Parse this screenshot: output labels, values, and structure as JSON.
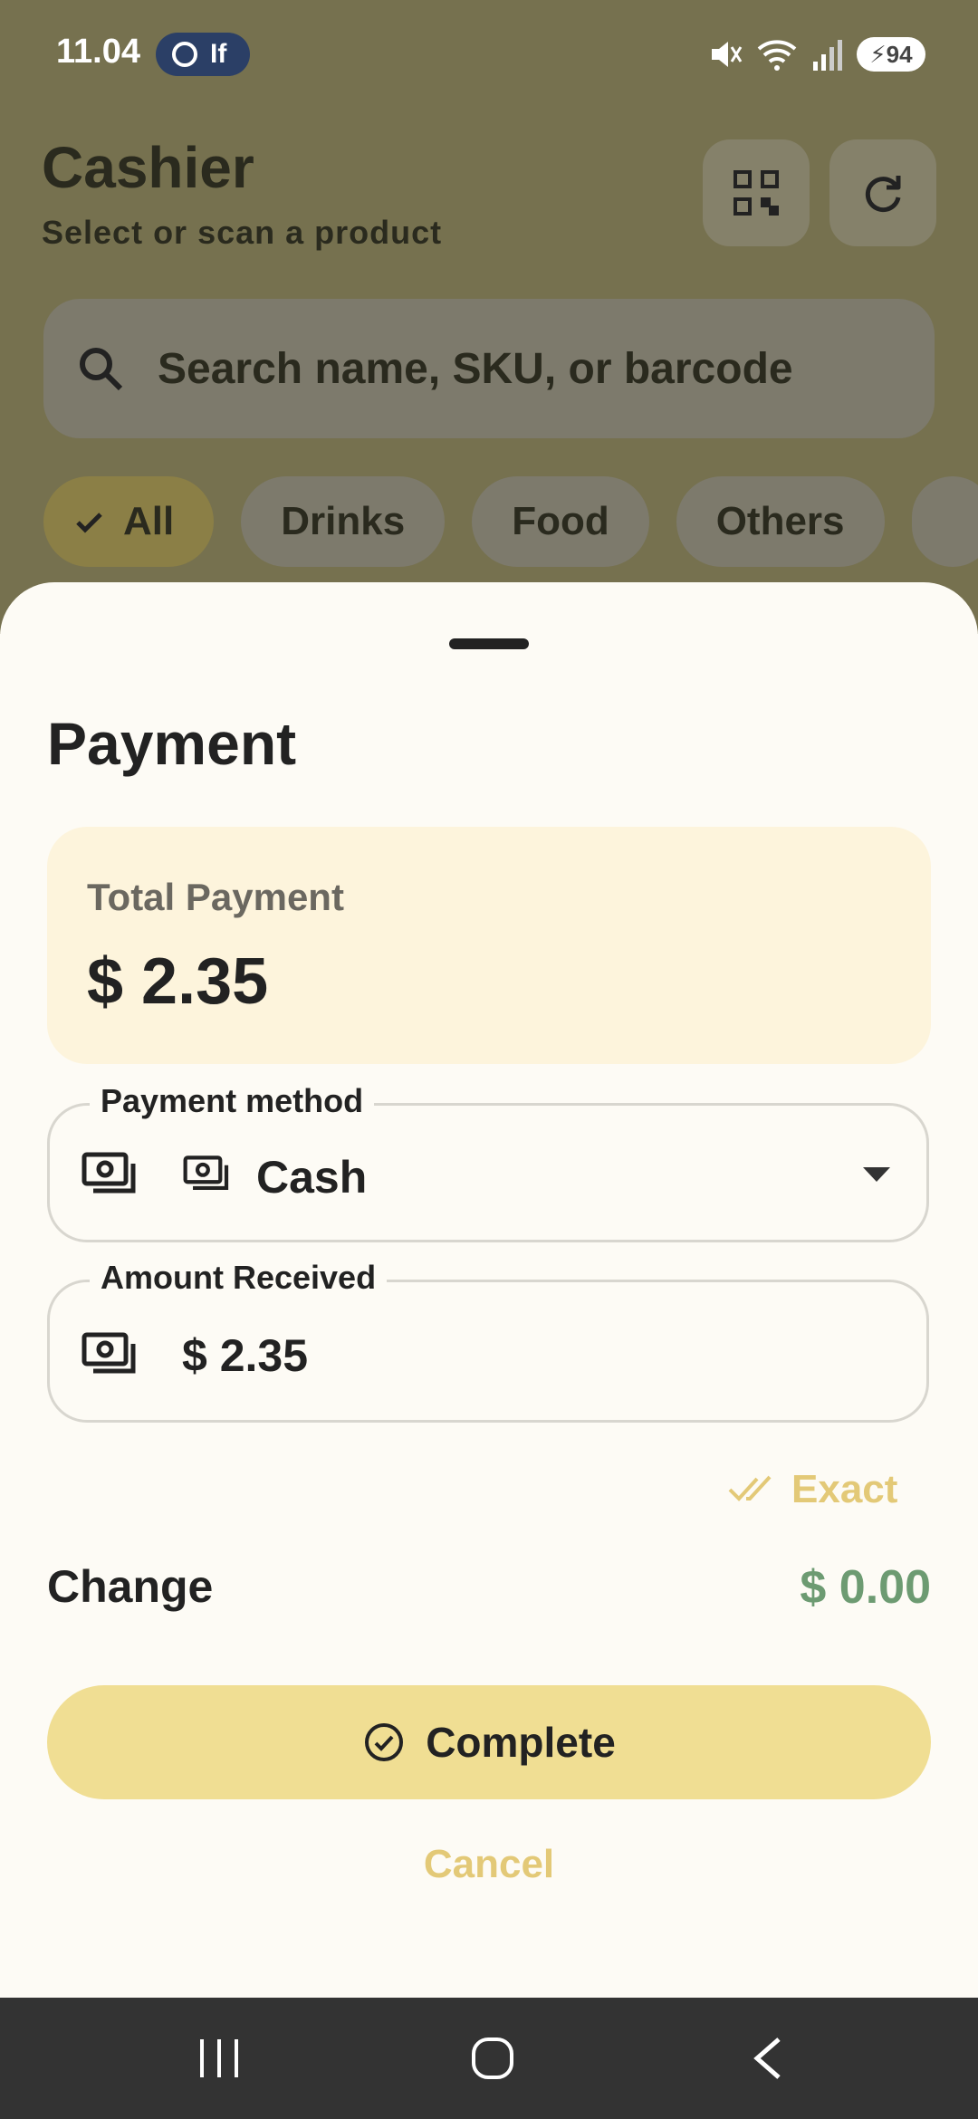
{
  "status_bar": {
    "time": "11.04",
    "app_pill": "If",
    "battery": "94"
  },
  "header": {
    "title": "Cashier",
    "subtitle": "Select or scan a product"
  },
  "search": {
    "placeholder": "Search name, SKU, or barcode"
  },
  "chips": [
    {
      "label": "All",
      "selected": true
    },
    {
      "label": "Drinks",
      "selected": false
    },
    {
      "label": "Food",
      "selected": false
    },
    {
      "label": "Others",
      "selected": false
    }
  ],
  "sheet": {
    "title": "Payment",
    "total_label": "Total Payment",
    "total_value": "$ 2.35",
    "payment_method_label": "Payment method",
    "payment_method_value": "Cash",
    "amount_label": "Amount Received",
    "amount_value": "$ 2.35",
    "exact_label": "Exact",
    "change_label": "Change",
    "change_value": "$ 0.00",
    "complete_label": "Complete",
    "cancel_label": "Cancel"
  },
  "icons": {
    "qr": "qr-scan-icon",
    "refresh": "refresh-icon",
    "search": "search-icon",
    "cash": "cash-icon",
    "dropdown": "dropdown-arrow-icon",
    "exact": "double-check-icon",
    "complete": "check-circle-icon"
  },
  "colors": {
    "accent": "#f0de93",
    "accent_text": "#e3c977",
    "change": "#6d9b72",
    "header_bg": "#76714f"
  }
}
